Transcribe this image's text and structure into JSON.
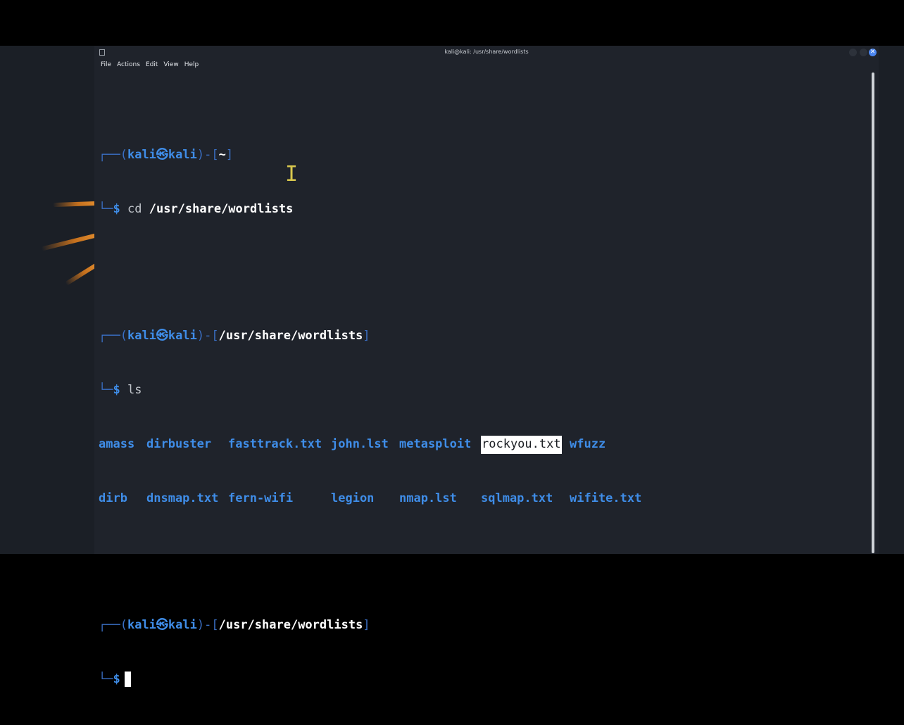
{
  "window": {
    "title": "kali@kali: /usr/share/wordlists",
    "close_glyph": "✕"
  },
  "menu": [
    "File",
    "Actions",
    "Edit",
    "View",
    "Help"
  ],
  "prompt": {
    "corner_top": "┌──",
    "corner_bottom": "└─",
    "open_paren": "(",
    "user": "kali",
    "at_glyph": "㉿",
    "host": "kali",
    "close_paren": ")",
    "dash_bracket_open": "-[",
    "bracket_close": "]",
    "dollar": "$"
  },
  "session": [
    {
      "cwd": "~",
      "command_name": "cd",
      "command_arg": "/usr/share/wordlists"
    },
    {
      "cwd": "/usr/share/wordlists",
      "command_name": "ls",
      "command_arg": ""
    },
    {
      "cwd": "/usr/share/wordlists"
    }
  ],
  "ls_output": {
    "row1": [
      "amass",
      "dirbuster",
      "fasttrack.txt",
      "john.lst",
      "metasploit",
      "rockyou.txt",
      "wfuzz"
    ],
    "row2": [
      "dirb",
      "dnsmap.txt",
      "fern-wifi",
      "legion",
      "nmap.lst",
      "sqlmap.txt",
      "wifite.txt"
    ],
    "highlighted": "rockyou.txt"
  },
  "colors": {
    "prompt_blue": "#3f8de8",
    "frame_blue": "#3a6fc4",
    "background": "#1f232b",
    "dragon_orange": "#c4701e"
  }
}
